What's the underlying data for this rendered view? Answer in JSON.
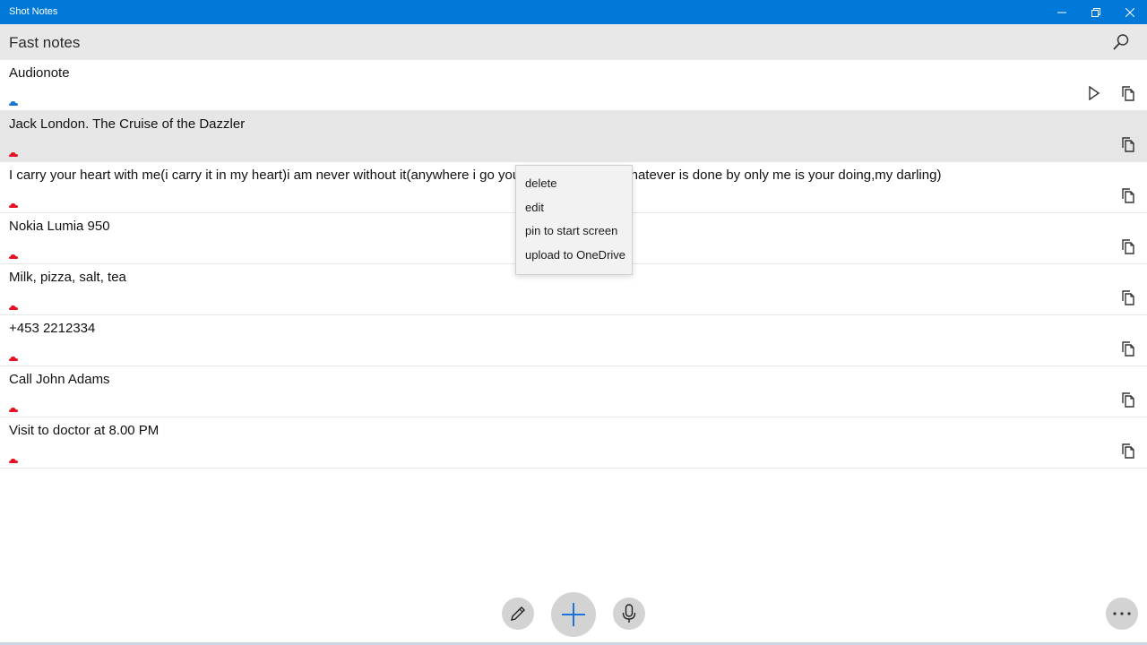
{
  "window": {
    "title": "Shot Notes"
  },
  "header": {
    "title": "Fast notes",
    "search_icon": "search-icon"
  },
  "notes": [
    {
      "text": "Audionote",
      "cloud_color": "#1976d2",
      "has_play": true
    },
    {
      "text": "Jack London. The Cruise of the Dazzler",
      "cloud_color": "#e81123",
      "selected": true
    },
    {
      "text": "I carry your heart with me(i carry it in my heart)i am never without it(anywhere i go you go,my dear;and whatever is done by only me is your doing,my darling)",
      "cloud_color": "#e81123"
    },
    {
      "text": "Nokia Lumia 950",
      "cloud_color": "#e81123"
    },
    {
      "text": "Milk, pizza, salt, tea",
      "cloud_color": "#e81123"
    },
    {
      "text": "+453 2212334",
      "cloud_color": "#e81123"
    },
    {
      "text": "Call John Adams",
      "cloud_color": "#e81123"
    },
    {
      "text": "Visit to doctor at 8.00 PM",
      "cloud_color": "#e81123"
    }
  ],
  "context_menu": {
    "items": [
      "delete",
      "edit",
      "pin to start screen",
      "upload to OneDrive"
    ]
  },
  "colors": {
    "accent": "#0078d7",
    "header_bg": "#e8e8e8",
    "selected_row": "#e6e6e6",
    "fab_bg": "#d3d3d3",
    "add_icon": "#1a73d9"
  }
}
